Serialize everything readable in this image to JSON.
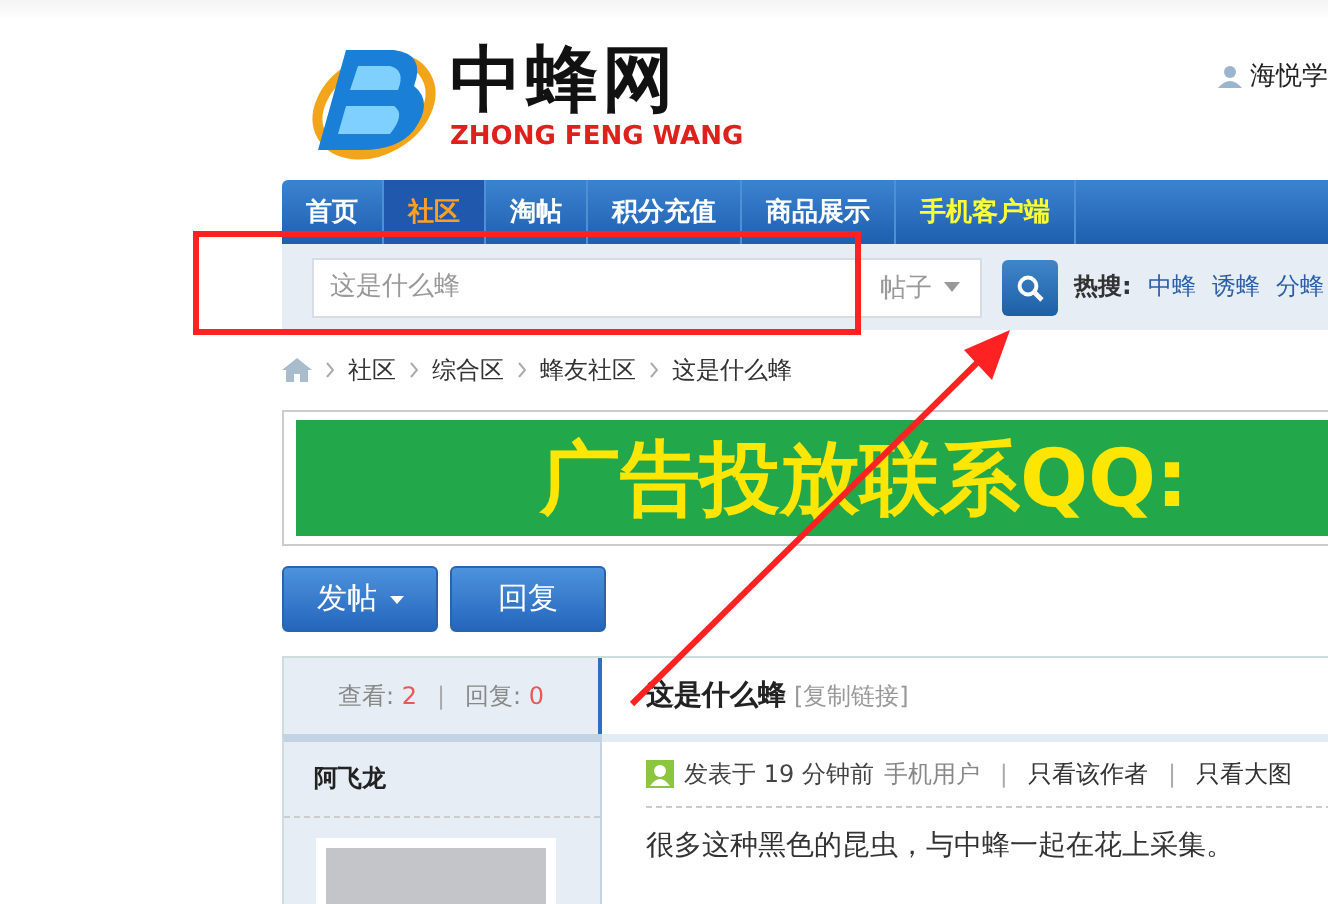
{
  "header": {
    "logo_title": "中蜂网",
    "logo_subtitle": "ZHONG FENG WANG",
    "user": "海悦学"
  },
  "nav": [
    {
      "label": "首页",
      "selected": false,
      "kind": "normal"
    },
    {
      "label": "社区",
      "selected": true,
      "kind": "normal"
    },
    {
      "label": "淘帖",
      "selected": false,
      "kind": "normal"
    },
    {
      "label": "积分充值",
      "selected": false,
      "kind": "normal"
    },
    {
      "label": "商品展示",
      "selected": false,
      "kind": "normal"
    },
    {
      "label": "手机客户端",
      "selected": false,
      "kind": "app"
    }
  ],
  "search": {
    "placeholder": "这是什么蜂",
    "scope": "帖子",
    "hot_label": "热搜:",
    "hot": [
      "中蜂",
      "诱蜂",
      "分蜂"
    ]
  },
  "breadcrumb": [
    "社区",
    "综合区",
    "蜂友社区",
    "这是什么蜂"
  ],
  "banner": {
    "text": "广告投放联系QQ:"
  },
  "actions": [
    {
      "label": "发帖",
      "dropdown": true
    },
    {
      "label": "回复",
      "dropdown": false
    }
  ],
  "thread": {
    "stats": [
      {
        "label": "查看:",
        "value": "2"
      },
      {
        "label": "回复:",
        "value": "0"
      }
    ],
    "stats_separator": "|",
    "title": "这是什么蜂",
    "copy_link": "[复制链接]"
  },
  "post": {
    "author": "阿飞龙",
    "posted": "发表于 19 分钟前",
    "device": "手机用户",
    "links": [
      {
        "separator": "|",
        "label": "只看该作者"
      },
      {
        "separator": "|",
        "label": "只看大图"
      }
    ],
    "body": "很多这种黑色的昆虫，与中蜂一起在花上采集。"
  }
}
